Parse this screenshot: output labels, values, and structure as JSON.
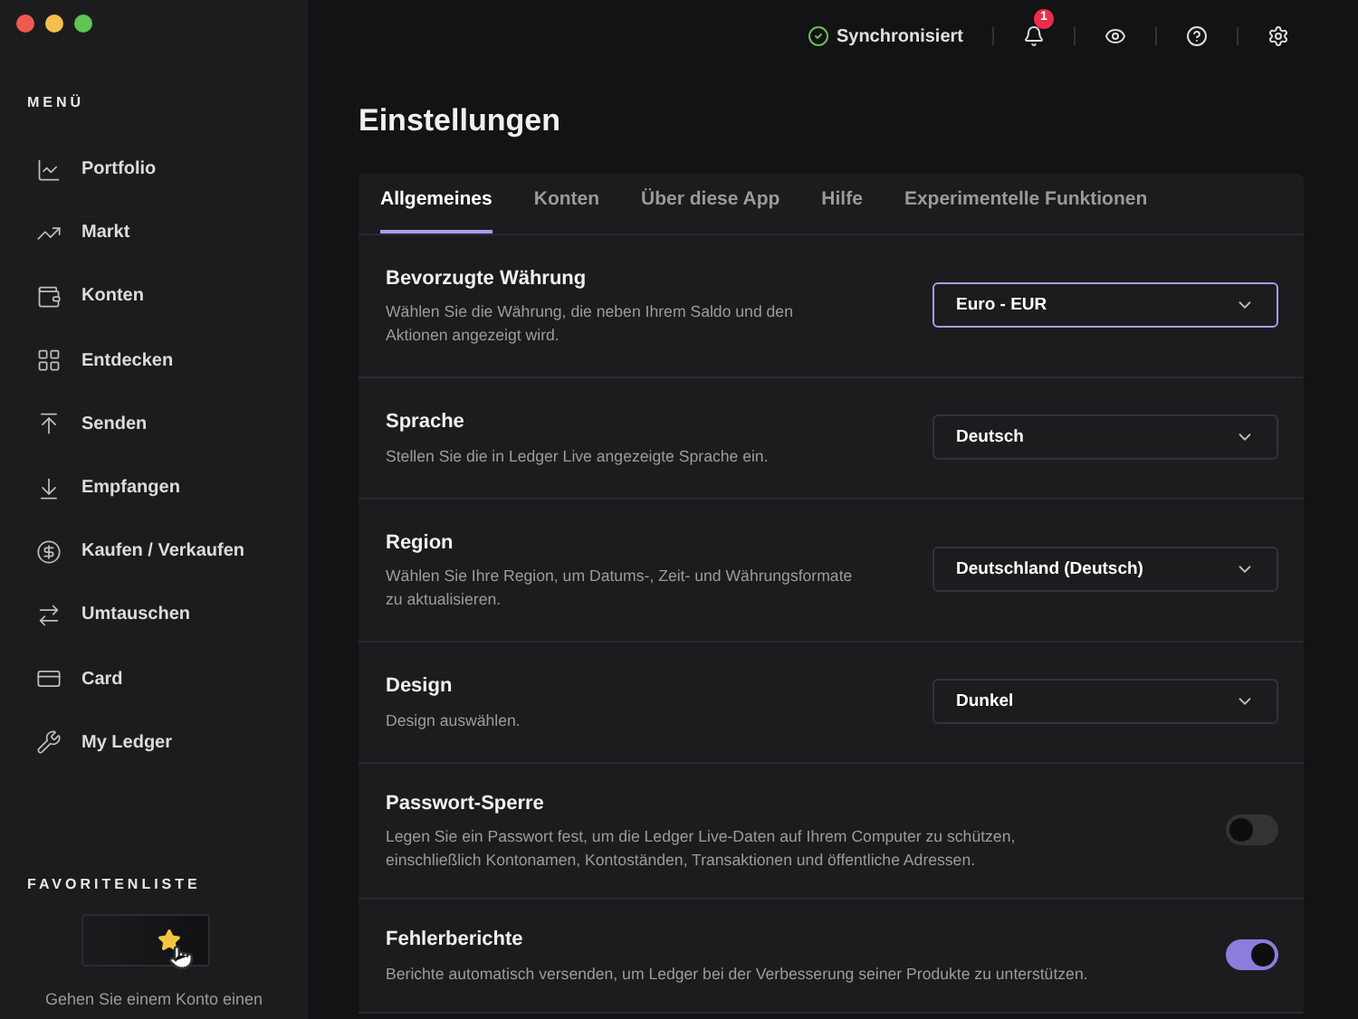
{
  "sidebar": {
    "menu_title": "MENÜ",
    "items": [
      {
        "label": "Portfolio",
        "selected": false
      },
      {
        "label": "Markt",
        "selected": false
      },
      {
        "label": "Konten",
        "selected": false
      },
      {
        "label": "Entdecken",
        "selected": false
      },
      {
        "label": "Senden",
        "selected": false
      },
      {
        "label": "Empfangen",
        "selected": false
      },
      {
        "label": "Kaufen / Verkaufen",
        "selected": false
      },
      {
        "label": "Umtauschen",
        "selected": false
      },
      {
        "label": "Card",
        "selected": false
      },
      {
        "label": "My Ledger",
        "selected": false
      }
    ],
    "favorites_title": "FAVORITENLISTE",
    "favorites_hint": "Gehen Sie einem Konto einen"
  },
  "topbar": {
    "sync_status": "Synchronisiert",
    "notification_count": "1"
  },
  "page_title": "Einstellungen",
  "tabs": [
    {
      "label": "Allgemeines",
      "selected": true
    },
    {
      "label": "Konten",
      "selected": false
    },
    {
      "label": "Über diese App",
      "selected": false
    },
    {
      "label": "Hilfe",
      "selected": false
    },
    {
      "label": "Experimentelle Funktionen",
      "selected": false
    }
  ],
  "settings": [
    {
      "kind": "select",
      "title": "Bevorzugte Währung",
      "description": "Wählen Sie die Währung, die neben Ihrem Saldo und den Aktionen angezeigt wird.",
      "value": "Euro - EUR",
      "focused": true
    },
    {
      "kind": "select",
      "title": "Sprache",
      "description": "Stellen Sie die in Ledger Live angezeigte Sprache ein.",
      "value": "Deutsch",
      "focused": false
    },
    {
      "kind": "select",
      "title": "Region",
      "description": "Wählen Sie Ihre Region, um Datums-, Zeit- und Währungsformate zu aktualisieren.",
      "value": "Deutschland (Deutsch)",
      "focused": false
    },
    {
      "kind": "select",
      "title": "Design",
      "description": "Design auswählen.",
      "value": "Dunkel",
      "focused": false
    },
    {
      "kind": "toggle",
      "title": "Passwort-Sperre",
      "description": "Legen Sie ein Passwort fest, um die Ledger Live-Daten auf Ihrem Computer zu schützen, einschließlich Kontonamen, Kontoständen, Transaktionen und öffentliche Adressen.",
      "on": false
    },
    {
      "kind": "toggle",
      "title": "Fehlerberichte",
      "description": "Berichte automatisch versenden, um Ledger bei der Verbesserung seiner Produkte zu unterstützen.",
      "on": true
    }
  ]
}
